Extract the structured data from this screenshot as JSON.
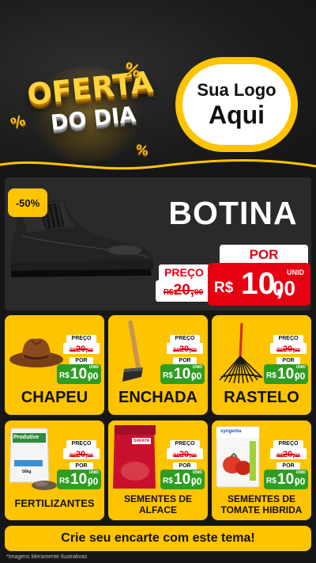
{
  "header": {
    "badge_line1": "OFERTA",
    "badge_line2": "DO DIA",
    "percent_symbol": "%",
    "logo_line1": "Sua Logo",
    "logo_line2": "Aqui"
  },
  "hero": {
    "discount": "-50%",
    "title": "BOTINA",
    "preco_label": "PREÇO",
    "old_currency": "R$",
    "old_value": "20,",
    "old_cents": "00",
    "por_label": "POR",
    "unid_label": "UNID",
    "new_currency": "R$",
    "new_value": "10,",
    "new_cents": "00"
  },
  "price_tag": {
    "preco_label": "PREÇO",
    "old_currency": "R$",
    "old_value": "20,",
    "old_cents": "00",
    "por_label": "POR",
    "unid_label": "UNID",
    "new_currency": "R$",
    "new_value": "10,",
    "new_cents": "00"
  },
  "products": [
    {
      "name": "CHAPEU"
    },
    {
      "name": "ENCHADA"
    },
    {
      "name": "RASTELO"
    },
    {
      "name": "FERTILIZANTES",
      "package_text": "Produtive",
      "package_weight": "50kg"
    },
    {
      "name": "SEMENTES DE ALFACE",
      "package_brand": "SAKATA"
    },
    {
      "name": "SEMENTES DE TOMATE HIBRIDA",
      "package_brand": "syngenta"
    }
  ],
  "footer": {
    "cta": "Crie seu encarte com este tema!",
    "note": "*Imagens Meramente Ilustrativas"
  },
  "colors": {
    "yellow": "#ffc400",
    "red": "#e60012",
    "green": "#2e9e22",
    "dark": "#161616"
  }
}
